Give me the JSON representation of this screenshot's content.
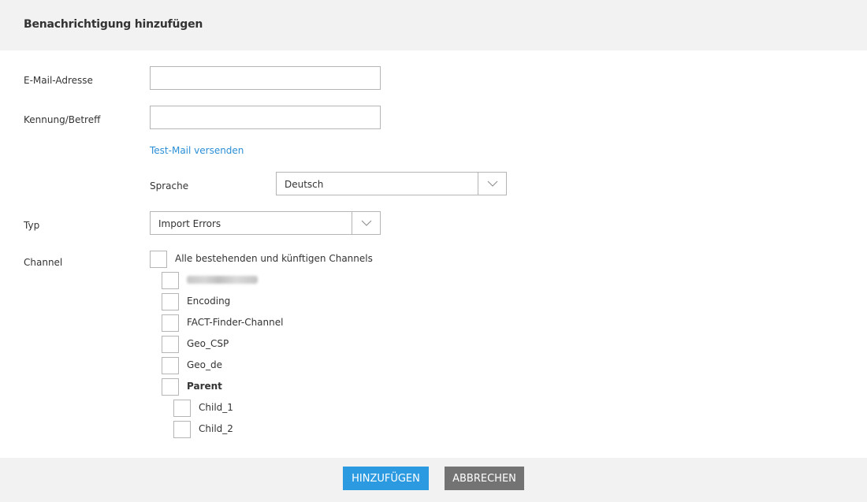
{
  "dialog": {
    "title": "Benachrichtigung hinzufügen"
  },
  "form": {
    "email": {
      "label": "E-Mail-Adresse",
      "value": "",
      "placeholder": ""
    },
    "subject": {
      "label": "Kennung/Betreff",
      "value": "",
      "placeholder": ""
    },
    "test_mail_link": "Test-Mail versenden",
    "language": {
      "label": "Sprache",
      "selected": "Deutsch"
    },
    "type": {
      "label": "Typ",
      "selected": "Import Errors"
    },
    "channel": {
      "label": "Channel",
      "all_label": "Alle bestehenden und künftigen Channels",
      "items": [
        {
          "label": "",
          "checked": false,
          "redacted": true
        },
        {
          "label": "Encoding",
          "checked": false
        },
        {
          "label": "FACT-Finder-Channel",
          "checked": false
        },
        {
          "label": "Geo_CSP",
          "checked": false
        },
        {
          "label": "Geo_de",
          "checked": false
        },
        {
          "label": "Parent",
          "checked": false,
          "bold": true
        },
        {
          "label": "Child_1",
          "checked": false
        },
        {
          "label": "Child_2",
          "checked": false
        }
      ]
    }
  },
  "footer": {
    "add_label": "HINZUFÜGEN",
    "cancel_label": "ABBRECHEN"
  },
  "colors": {
    "accent": "#2c9ae0",
    "link": "#2b8fd6",
    "secondary": "#737373",
    "panel": "#f2f2f2"
  },
  "icons": {
    "select_toggle": "chevron-down-icon"
  }
}
